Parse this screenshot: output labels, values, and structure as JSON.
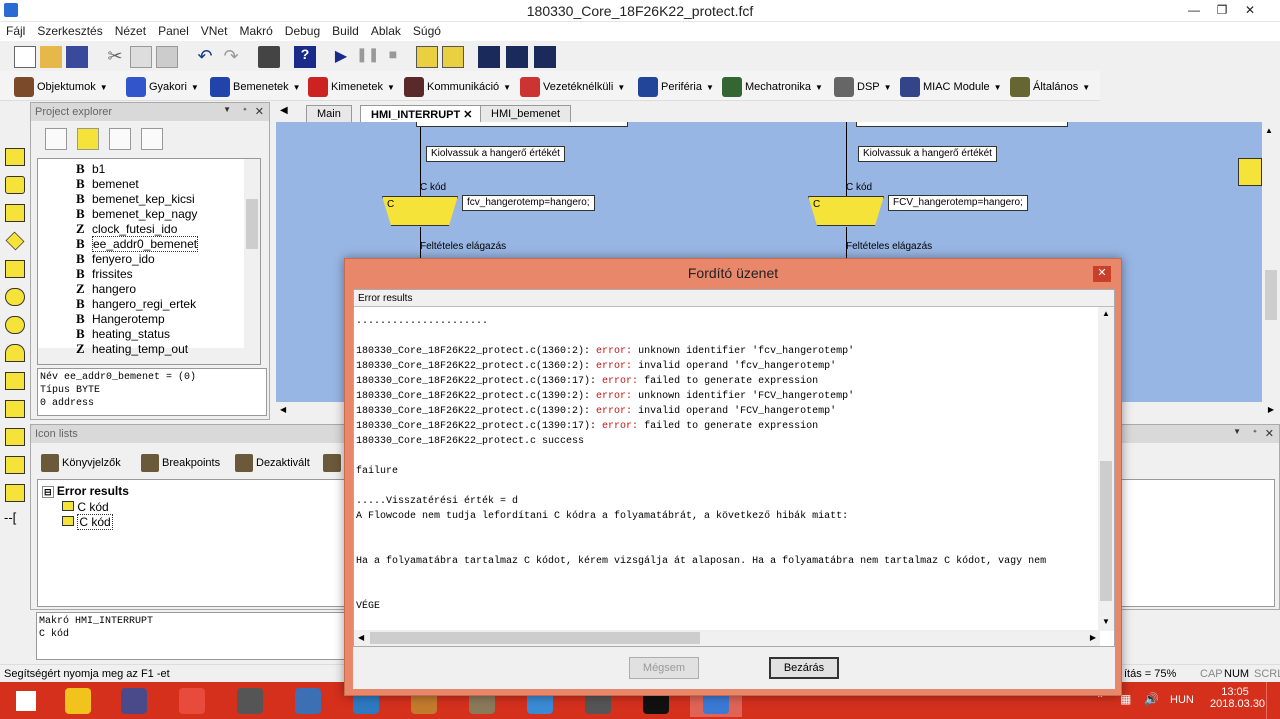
{
  "window": {
    "title": "180330_Core_18F26K22_protect.fcf"
  },
  "menu": [
    "Fájl",
    "Szerkesztés",
    "Nézet",
    "Panel",
    "VNet",
    "Makró",
    "Debug",
    "Build",
    "Ablak",
    "Súgó"
  ],
  "component_toolbar": [
    {
      "label": "Objektumok",
      "color": "#7a4a2a"
    },
    {
      "label": "Gyakori",
      "color": "#3355cc"
    },
    {
      "label": "Bemenetek",
      "color": "#2244aa"
    },
    {
      "label": "Kimenetek",
      "color": "#cc2222"
    },
    {
      "label": "Kommunikáció",
      "color": "#5a2a2a"
    },
    {
      "label": "Vezetéknélküli",
      "color": "#cc3333"
    },
    {
      "label": "Periféria",
      "color": "#224499"
    },
    {
      "label": "Mechatronika",
      "color": "#336633"
    },
    {
      "label": "DSP",
      "color": "#666666"
    },
    {
      "label": "MIAC Module",
      "color": "#334488"
    },
    {
      "label": "Általános",
      "color": "#666633"
    }
  ],
  "project_explorer": {
    "title": "Project explorer",
    "variables": [
      {
        "type": "B",
        "name": "b1"
      },
      {
        "type": "B",
        "name": "bemenet"
      },
      {
        "type": "B",
        "name": "bemenet_kep_kicsi"
      },
      {
        "type": "B",
        "name": "bemenet_kep_nagy"
      },
      {
        "type": "Z",
        "name": "clock_futesi_ido"
      },
      {
        "type": "B",
        "name": "ee_addr0_bemenet"
      },
      {
        "type": "B",
        "name": "fenyero_ido"
      },
      {
        "type": "B",
        "name": "frissites"
      },
      {
        "type": "Z",
        "name": "hangero"
      },
      {
        "type": "B",
        "name": "hangero_regi_ertek"
      },
      {
        "type": "B",
        "name": "Hangerotemp"
      },
      {
        "type": "B",
        "name": "heating_status"
      },
      {
        "type": "Z",
        "name": "heating_temp_out"
      }
    ],
    "info": [
      "Név   ee_addr0_bemenet = (0)",
      "Típus BYTE",
      "0 address"
    ]
  },
  "tabs": [
    {
      "label": "Main"
    },
    {
      "label": "HMI_INTERRUPT"
    },
    {
      "label": "HMI_bemenet"
    }
  ],
  "flowchart": {
    "left": {
      "comment": "Kiolvassuk a hangerő értékét",
      "c_label": "C kód",
      "c_block": "C",
      "c_code": "fcv_hangerotemp=hangero;",
      "decision": "Feltételes elágazás"
    },
    "right": {
      "comment": "Kiolvassuk a hangerő értékét",
      "c_label": "C kód",
      "c_block": "C",
      "c_code": "FCV_hangerotemp=hangero;",
      "decision": "Feltételes elágazás"
    }
  },
  "icon_lists": {
    "title": "Icon lists",
    "toolbar": [
      "Könyvjelzők",
      "Breakpoints",
      "Dezaktivált"
    ],
    "tree_root": "Error results",
    "tree_items": [
      "C kód",
      "C kód"
    ],
    "macro_info": [
      "Makró HMI_INTERRUPT",
      "C kód"
    ]
  },
  "dialog": {
    "title": "Fordító üzenet",
    "results_header": "Error results",
    "lines": [
      {
        "text": "......................",
        "err": ""
      },
      {
        "text": "",
        "err": ""
      },
      {
        "pre": "180330_Core_18F26K22_protect.c(1360:2): ",
        "err": "error:",
        "post": " unknown identifier 'fcv_hangerotemp'"
      },
      {
        "pre": "180330_Core_18F26K22_protect.c(1360:2): ",
        "err": "error:",
        "post": " invalid operand 'fcv_hangerotemp'"
      },
      {
        "pre": "180330_Core_18F26K22_protect.c(1360:17): ",
        "err": "error:",
        "post": " failed to generate expression"
      },
      {
        "pre": "180330_Core_18F26K22_protect.c(1390:2): ",
        "err": "error:",
        "post": " unknown identifier 'FCV_hangerotemp'"
      },
      {
        "pre": "180330_Core_18F26K22_protect.c(1390:2): ",
        "err": "error:",
        "post": " invalid operand 'FCV_hangerotemp'"
      },
      {
        "pre": "180330_Core_18F26K22_protect.c(1390:17): ",
        "err": "error:",
        "post": " failed to generate expression"
      },
      {
        "text": "180330_Core_18F26K22_protect.c success",
        "err": ""
      },
      {
        "text": "",
        "err": ""
      },
      {
        "text": "failure",
        "err": ""
      },
      {
        "text": "",
        "err": ""
      },
      {
        "text": ".....Visszatérési érték = d",
        "err": ""
      },
      {
        "text": "A Flowcode nem tudja lefordítani C kódra a folyamatábrát, a következő hibák miatt:",
        "err": ""
      },
      {
        "text": "",
        "err": ""
      },
      {
        "text": "",
        "err": ""
      },
      {
        "text": "Ha a folyamatábra tartalmaz C kódot, kérem vizsgálja át alaposan. Ha a folyamatábra nem tartalmaz C kódot, vagy nem",
        "err": ""
      },
      {
        "text": "",
        "err": ""
      },
      {
        "text": "",
        "err": ""
      },
      {
        "text": "VÉGE",
        "err": ""
      }
    ],
    "cancel_label": "Mégsem",
    "close_label": "Bezárás"
  },
  "statusbar": {
    "help": "Segítségért nyomja meg az F1 -et",
    "zoom": "ítás = 75%",
    "cap": "CAP",
    "num": "NUM",
    "scrl": "SCRL"
  },
  "taskbar": {
    "apps": [
      {
        "name": "start",
        "color": "#ffffff"
      },
      {
        "name": "flowcode",
        "color": "#f2c21d"
      },
      {
        "name": "disk-app",
        "color": "#4a4a8a"
      },
      {
        "name": "chrome",
        "color": "#e84b3c"
      },
      {
        "name": "media-app",
        "color": "#555555"
      },
      {
        "name": "mail-app",
        "color": "#3c6fb4"
      },
      {
        "name": "pl-app",
        "color": "#2d7ac2"
      },
      {
        "name": "paint-app",
        "color": "#c27a2d"
      },
      {
        "name": "gimp-app",
        "color": "#8a7a5a"
      },
      {
        "name": "mplab-app",
        "color": "#3a8ad4"
      },
      {
        "name": "programmer-app",
        "color": "#555555"
      },
      {
        "name": "pickit-app",
        "color": "#111111"
      },
      {
        "name": "flowcode-active",
        "color": "#3a7ad4"
      }
    ],
    "lang": "HUN",
    "time": "13:05",
    "date": "2018.03.30."
  }
}
